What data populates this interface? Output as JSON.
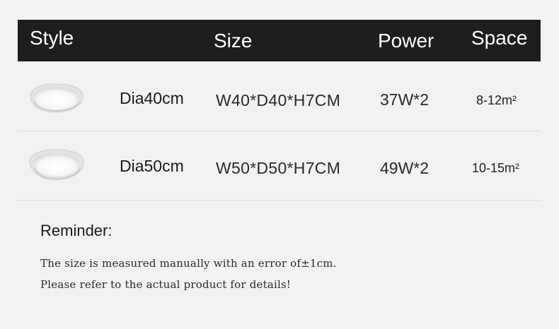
{
  "header": {
    "style": "Style",
    "size": "Size",
    "power": "Power",
    "space": "Space"
  },
  "rows": [
    {
      "image": "round-ceiling-lamp-40",
      "diameter": "Dia40cm",
      "size": "W40*D40*H7CM",
      "power": "37W*2",
      "space": "8-12m²"
    },
    {
      "image": "round-ceiling-lamp-50",
      "diameter": "Dia50cm",
      "size": "W50*D50*H7CM",
      "power": "49W*2",
      "space": "10-15m²"
    }
  ],
  "reminder": {
    "title": "Reminder:",
    "line1": "The size is measured manually with an error of±1cm.",
    "line2": "Please refer to the actual product for details!"
  },
  "colors": {
    "background": "#f2f2f2",
    "header_bg": "#1e1e1e",
    "header_text": "#ffffff",
    "divider": "#dcdcdc"
  }
}
